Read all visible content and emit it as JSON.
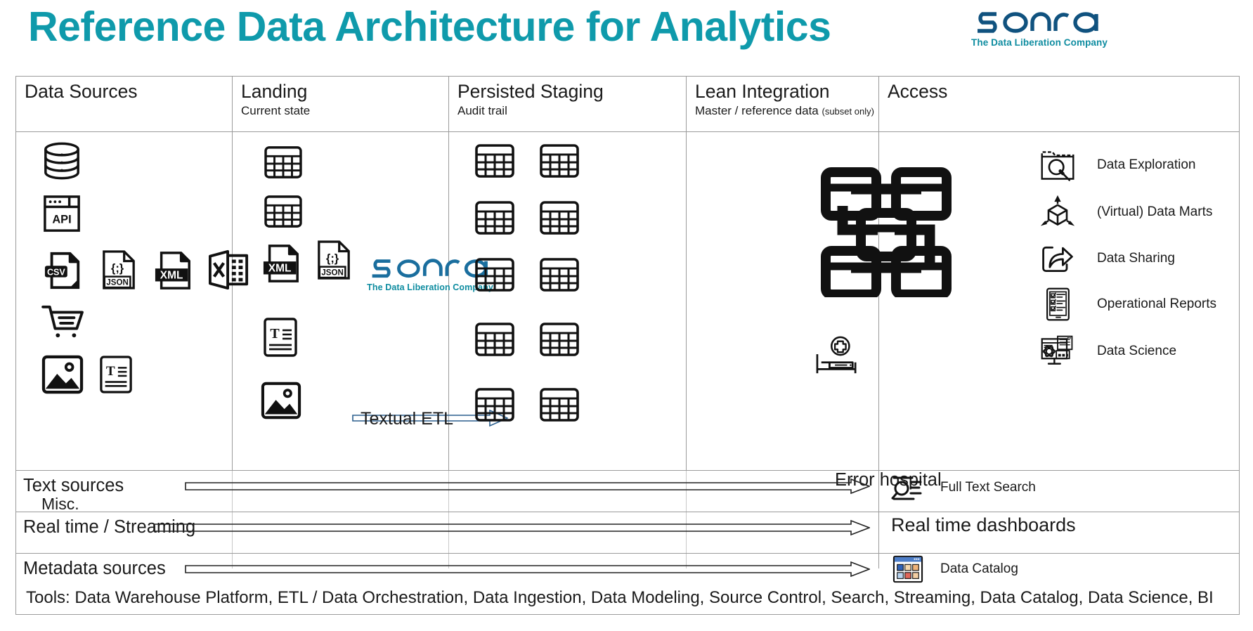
{
  "header": {
    "title": "Reference Data Architecture for Analytics",
    "title_color": "#0f9aab",
    "logo": {
      "wordmark": "sonra",
      "tagline": "The Data Liberation Company",
      "wordmark_color": "#10527f",
      "tagline_color": "#0e8ca0"
    }
  },
  "columns": [
    {
      "title": "Data Sources",
      "subtitle": "",
      "subtitle_note": ""
    },
    {
      "title": "Landing",
      "subtitle": "Current state",
      "subtitle_note": ""
    },
    {
      "title": "Persisted Staging",
      "subtitle": "Audit trail",
      "subtitle_note": ""
    },
    {
      "title": "Lean Integration",
      "subtitle": "Master / reference data",
      "subtitle_note": "(subset only)"
    },
    {
      "title": "Access",
      "subtitle": "",
      "subtitle_note": ""
    }
  ],
  "data_sources": {
    "misc_label": "Misc.",
    "icons": [
      "database-icon",
      "api-window-icon",
      "csv-file-icon",
      "json-file-icon",
      "xml-file-icon",
      "excel-file-icon",
      "shopping-cart-icon",
      "image-file-icon",
      "text-document-icon"
    ]
  },
  "landing": {
    "logo": {
      "wordmark": "sonra",
      "tagline": "The Data Liberation Company"
    },
    "textual_etl_label": "Textual ETL",
    "icons": [
      "table-icon",
      "table-icon",
      "xml-file-icon",
      "json-file-icon",
      "text-document-icon",
      "image-file-icon"
    ],
    "arrow": "textual-etl-arrow"
  },
  "persisted_staging": {
    "table_icon_count": 10,
    "table_icon_name": "table-icon",
    "rows": 5,
    "cols": 2
  },
  "lean_integration": {
    "network_icon": "data-model-network-icon",
    "error_hospital_label": "Error hospital",
    "error_hospital_icon": "hospital-bed-icon"
  },
  "access": {
    "items": [
      {
        "label": "Data Exploration",
        "icon": "folder-search-icon"
      },
      {
        "label": "(Virtual) Data Marts",
        "icon": "cube-arrows-icon"
      },
      {
        "label": "Data Sharing",
        "icon": "share-arrow-icon"
      },
      {
        "label": "Operational Reports",
        "icon": "checklist-tablet-icon"
      },
      {
        "label": "Data Science",
        "icon": "data-science-monitor-icon"
      }
    ]
  },
  "flow_rows": [
    {
      "label": "Text sources",
      "right_label": "Full Text Search",
      "right_icon": "text-search-icon",
      "right_big": false
    },
    {
      "label": "Real time / Streaming",
      "right_label": "Real time dashboards",
      "right_icon": "",
      "right_big": true
    },
    {
      "label": "Metadata sources",
      "right_label": "Data Catalog",
      "right_icon": "data-catalog-icon",
      "right_big": false
    }
  ],
  "footer": {
    "tools_text": "Tools: Data Warehouse Platform, ETL / Data Orchestration, Data Ingestion, Data Modeling, Source Control, Search, Streaming, Data Catalog, Data Science, BI"
  }
}
